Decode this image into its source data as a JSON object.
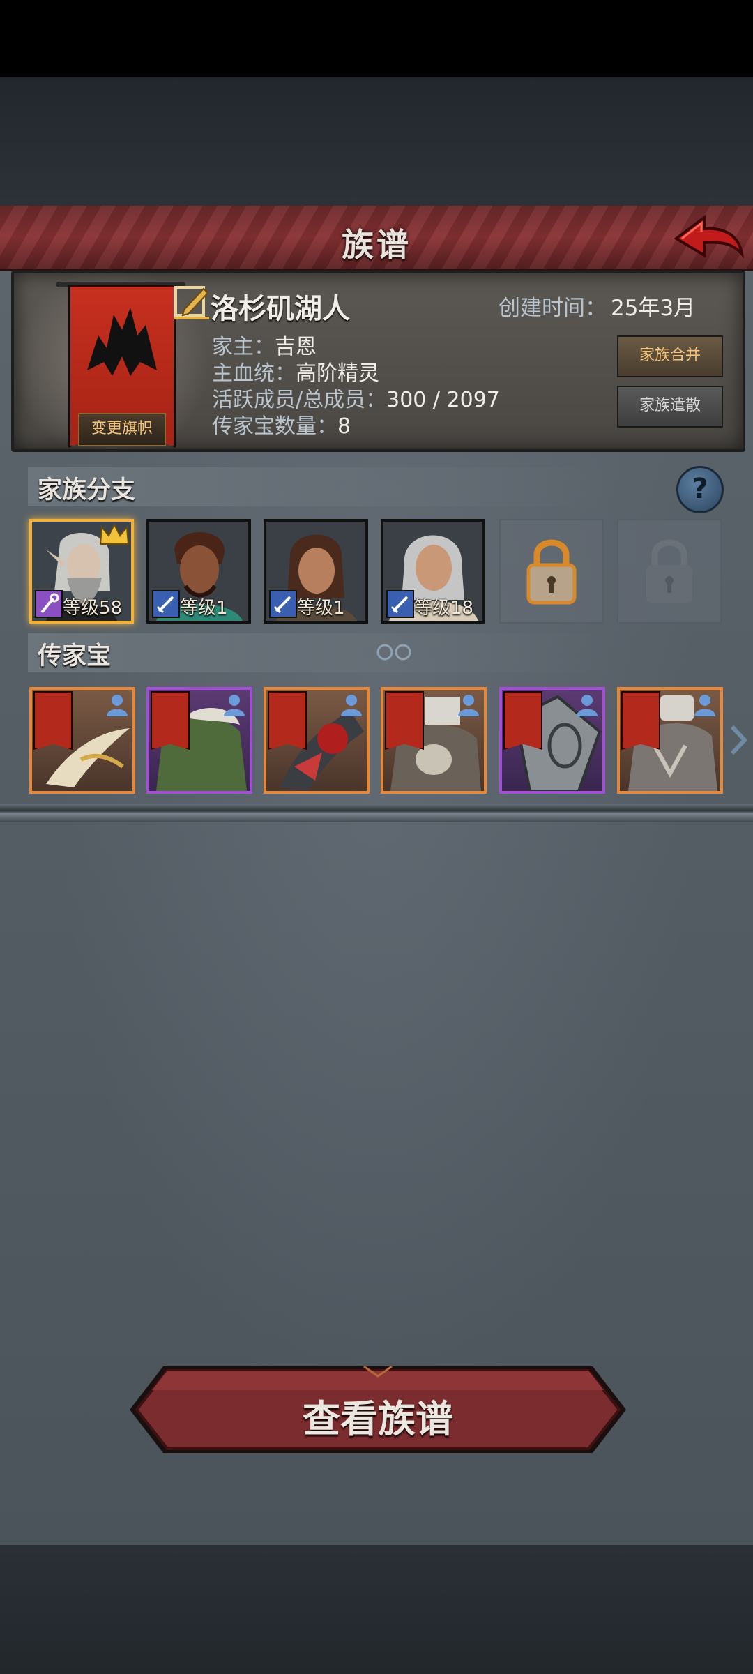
{
  "header": {
    "title": "族谱",
    "back_icon": "back-arrow-icon"
  },
  "family": {
    "name": "洛杉矶湖人",
    "created_label": "创建时间：",
    "created_value": "25年3月",
    "change_flag_label": "变更旗帜",
    "head_label": "家主：",
    "head_value": "吉恩",
    "bloodline_label": "主血统：",
    "bloodline_value": "高阶精灵",
    "members_label": "活跃成员/总成员：",
    "members_value": "300 / 2097",
    "heirloom_count_label": "传家宝数量：",
    "heirloom_count_value": "8",
    "merge_label": "家族合并",
    "disband_label": "家族遣散"
  },
  "branches": {
    "title": "家族分支",
    "help_label": "?",
    "members": [
      {
        "level_text": "等级58",
        "class_icon": "staff-icon",
        "badge_color": "#8a4fc0",
        "leader": true
      },
      {
        "level_text": "等级1",
        "class_icon": "sword-icon",
        "badge_color": "#3a5fb0",
        "leader": false
      },
      {
        "level_text": "等级1",
        "class_icon": "sword-icon",
        "badge_color": "#3a5fb0",
        "leader": false
      },
      {
        "level_text": "等级18",
        "class_icon": "sword-icon",
        "badge_color": "#3a5fb0",
        "leader": false
      }
    ],
    "locked_slots": [
      {
        "state": "unlockable",
        "icon": "padlock-icon"
      },
      {
        "state": "locked",
        "icon": "padlock-icon"
      }
    ]
  },
  "heirlooms": {
    "title": "传家宝",
    "items": [
      {
        "rarity": "orange",
        "art": "ornate-blade"
      },
      {
        "rarity": "purple",
        "art": "green-fur-armor"
      },
      {
        "rarity": "orange",
        "art": "demon-axe"
      },
      {
        "rarity": "orange",
        "art": "skull-armor"
      },
      {
        "rarity": "purple",
        "art": "silver-shield"
      },
      {
        "rarity": "orange",
        "art": "plate-armor"
      }
    ]
  },
  "footer": {
    "view_button_label": "查看族谱"
  }
}
